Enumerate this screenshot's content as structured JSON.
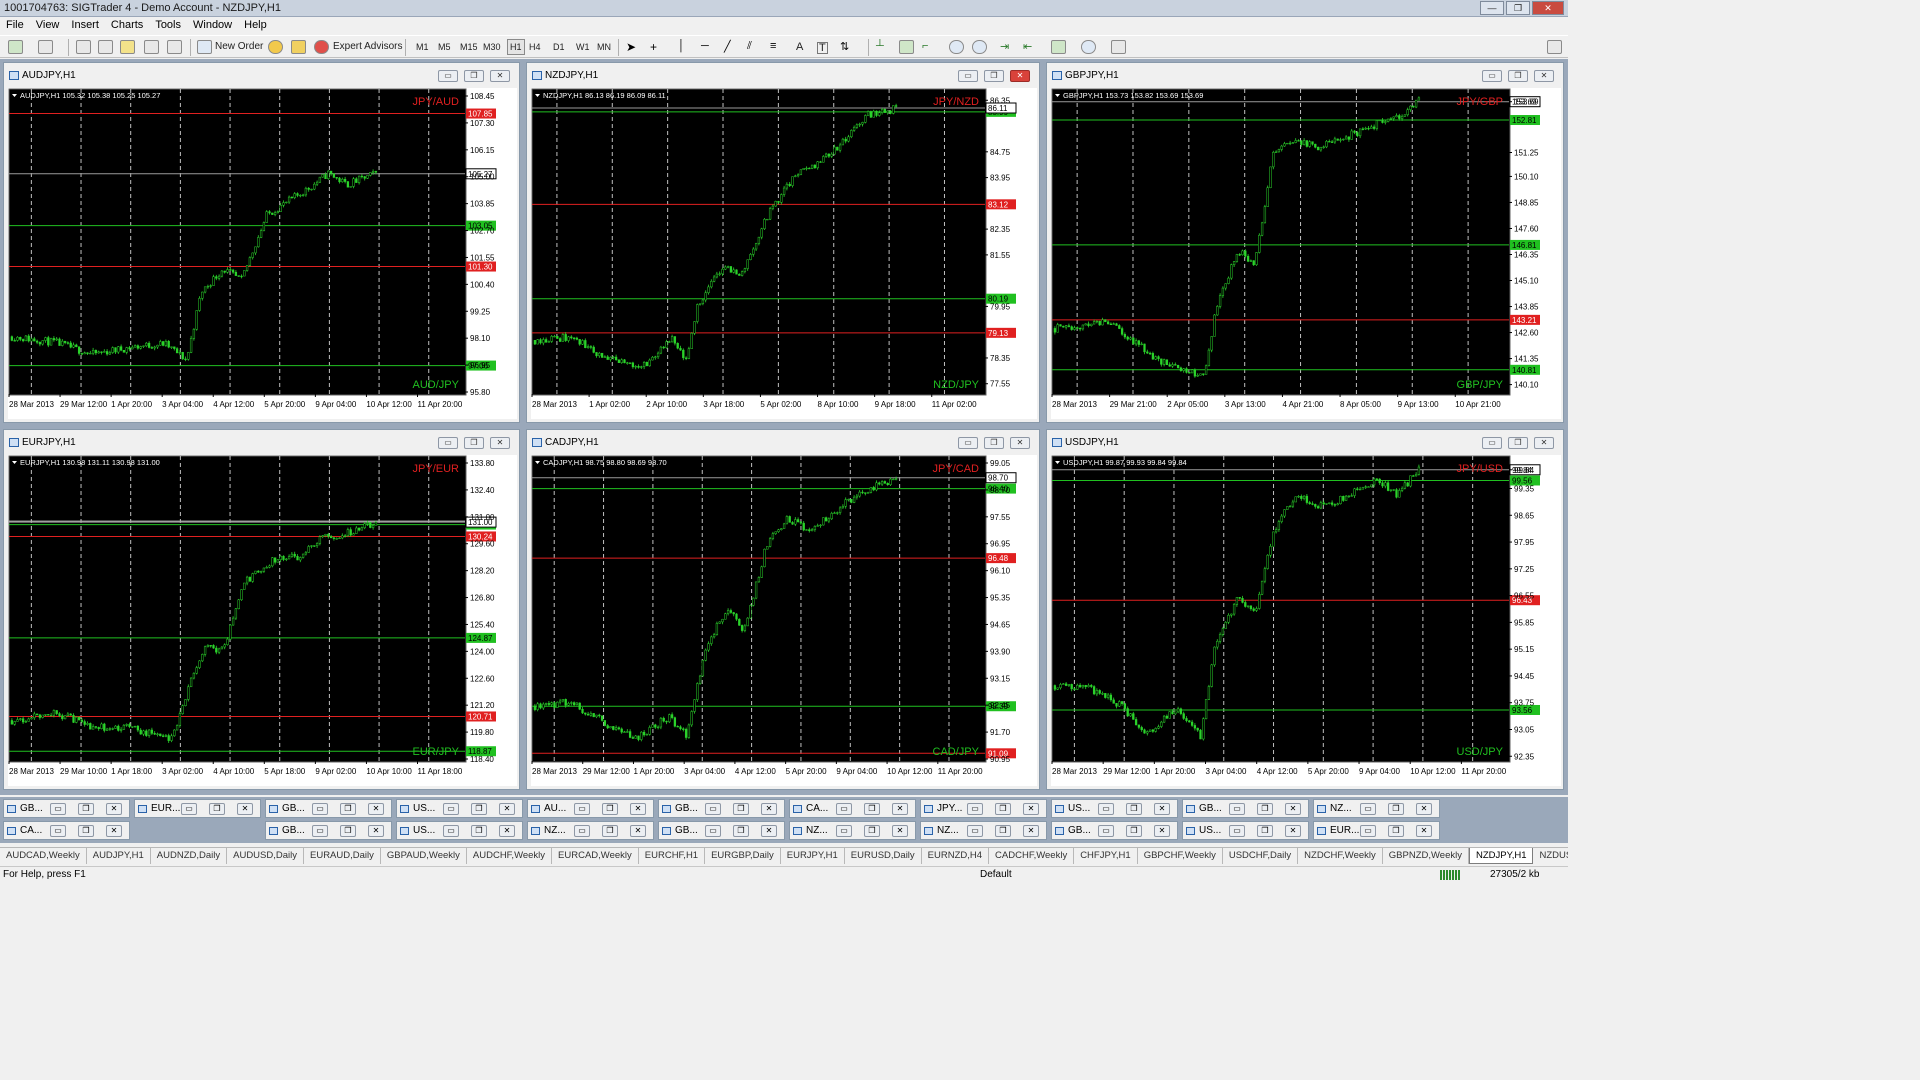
{
  "window": {
    "title": "1001704763: SIGTrader 4 - Demo Account - NZDJPY,H1"
  },
  "menu": [
    "File",
    "View",
    "Insert",
    "Charts",
    "Tools",
    "Window",
    "Help"
  ],
  "toolbar": {
    "new_order": "New Order",
    "expert_advisors": "Expert Advisors",
    "timeframes": [
      "M1",
      "M5",
      "M15",
      "M30",
      "H1",
      "H4",
      "D1",
      "W1",
      "MN"
    ],
    "text_tool": "A",
    "label_tool": "T"
  },
  "charts": [
    {
      "title": "AUDJPY,H1",
      "info": "AUDJPY,H1  105.32 105.38 105.25 105.27",
      "top_label": "JPY/AUD",
      "bottom_label": "AUD/JPY",
      "yticks": [
        "108.45",
        "107.30",
        "106.15",
        "105.00",
        "103.85",
        "102.70",
        "101.55",
        "100.40",
        "99.25",
        "98.10",
        "96.95",
        "95.80"
      ],
      "xticks": [
        "28 Mar 2013",
        "29 Mar 12:00",
        "1 Apr 20:00",
        "3 Apr 04:00",
        "4 Apr 12:00",
        "5 Apr 20:00",
        "9 Apr 04:00",
        "10 Apr 12:00",
        "11 Apr 20:00"
      ],
      "ymin": 95.8,
      "ymax": 108.9,
      "hlines": [
        {
          "v": 107.85,
          "c": "red",
          "label": "107.85"
        },
        {
          "v": 103.05,
          "c": "green",
          "label": "103.05"
        },
        {
          "v": 101.3,
          "c": "red",
          "label": "101.30"
        },
        {
          "v": 97.06,
          "c": "green",
          "label": "97.06"
        }
      ],
      "price": {
        "v": 105.27,
        "label": "105.27"
      },
      "anchors": [
        [
          0,
          98.3
        ],
        [
          0.12,
          98.05
        ],
        [
          0.22,
          97.55
        ],
        [
          0.33,
          97.85
        ],
        [
          0.42,
          98.0
        ],
        [
          0.48,
          97.3
        ],
        [
          0.52,
          100.2
        ],
        [
          0.58,
          101.2
        ],
        [
          0.63,
          100.7
        ],
        [
          0.7,
          103.5
        ],
        [
          0.76,
          104.1
        ],
        [
          0.82,
          104.7
        ],
        [
          0.87,
          105.3
        ],
        [
          0.92,
          104.8
        ],
        [
          1,
          105.3
        ]
      ],
      "seed": 11
    },
    {
      "title": "NZDJPY,H1",
      "info": "NZDJPY,H1  86.13 86.19 86.09 86.11",
      "top_label": "JPY/NZD",
      "bottom_label": "NZD/JPY",
      "yticks": [
        "86.35",
        "84.75",
        "83.95",
        "82.35",
        "81.55",
        "79.95",
        "78.35",
        "77.55"
      ],
      "yticks_v": [
        86.35,
        84.75,
        83.95,
        82.35,
        81.55,
        79.95,
        78.35,
        77.55
      ],
      "xticks": [
        "28 Mar 2013",
        "1 Apr 02:00",
        "2 Apr 10:00",
        "3 Apr 18:00",
        "5 Apr 02:00",
        "8 Apr 10:00",
        "9 Apr 18:00",
        "11 Apr 02:00"
      ],
      "ymin": 77.2,
      "ymax": 86.7,
      "hlines": [
        {
          "v": 85.99,
          "c": "green",
          "label": "85.99"
        },
        {
          "v": 83.12,
          "c": "red",
          "label": "83.12"
        },
        {
          "v": 80.19,
          "c": "green",
          "label": "80.19"
        },
        {
          "v": 79.13,
          "c": "red",
          "label": "79.13"
        }
      ],
      "price": {
        "v": 86.11,
        "label": "86.11"
      },
      "anchors": [
        [
          0,
          78.9
        ],
        [
          0.1,
          79.0
        ],
        [
          0.2,
          78.3
        ],
        [
          0.3,
          78.1
        ],
        [
          0.38,
          78.9
        ],
        [
          0.42,
          78.2
        ],
        [
          0.45,
          80.0
        ],
        [
          0.52,
          81.2
        ],
        [
          0.57,
          80.9
        ],
        [
          0.65,
          82.9
        ],
        [
          0.72,
          84.0
        ],
        [
          0.78,
          84.4
        ],
        [
          0.85,
          85.0
        ],
        [
          0.92,
          85.9
        ],
        [
          1,
          86.1
        ]
      ],
      "seed": 23
    },
    {
      "title": "GBPJPY,H1",
      "info": "GBPJPY,H1  153.73 153.82 153.69 153.69",
      "top_label": "JPY/GBP",
      "bottom_label": "GBP/JPY",
      "yticks": [
        "153.69",
        "151.25",
        "150.10",
        "148.85",
        "147.60",
        "146.35",
        "145.10",
        "143.85",
        "142.60",
        "141.35",
        "140.10"
      ],
      "yticks_v": [
        153.69,
        151.25,
        150.1,
        148.85,
        147.6,
        146.35,
        145.1,
        143.85,
        142.6,
        141.35,
        140.1
      ],
      "xticks": [
        "28 Mar 2013",
        "29 Mar 21:00",
        "2 Apr 05:00",
        "3 Apr 13:00",
        "4 Apr 21:00",
        "8 Apr 05:00",
        "9 Apr 13:00",
        "10 Apr 21:00"
      ],
      "ymin": 139.6,
      "ymax": 154.3,
      "hlines": [
        {
          "v": 152.81,
          "c": "green",
          "label": "152.81"
        },
        {
          "v": 146.81,
          "c": "green",
          "label": "146.81"
        },
        {
          "v": 143.21,
          "c": "red",
          "label": "143.21"
        },
        {
          "v": 140.81,
          "c": "green",
          "label": "140.81"
        }
      ],
      "price": {
        "v": 153.69,
        "label": "153.69"
      },
      "anchors": [
        [
          0,
          142.8
        ],
        [
          0.08,
          142.9
        ],
        [
          0.14,
          143.2
        ],
        [
          0.2,
          142.4
        ],
        [
          0.28,
          141.3
        ],
        [
          0.35,
          140.8
        ],
        [
          0.41,
          140.5
        ],
        [
          0.44,
          143.5
        ],
        [
          0.5,
          146.5
        ],
        [
          0.55,
          146.0
        ],
        [
          0.6,
          151.2
        ],
        [
          0.66,
          151.8
        ],
        [
          0.72,
          151.5
        ],
        [
          0.8,
          152.0
        ],
        [
          0.88,
          152.6
        ],
        [
          0.94,
          152.9
        ],
        [
          1,
          153.7
        ]
      ],
      "seed": 37
    },
    {
      "title": "EURJPY,H1",
      "info": "EURJPY,H1  130.98 131.11 130.98 131.00",
      "top_label": "JPY/EUR",
      "bottom_label": "EUR/JPY",
      "yticks": [
        "133.80",
        "132.40",
        "131.00",
        "129.60",
        "128.20",
        "126.80",
        "125.40",
        "124.00",
        "122.60",
        "121.20",
        "119.80",
        "118.40"
      ],
      "xticks": [
        "28 Mar 2013",
        "29 Mar 10:00",
        "1 Apr 18:00",
        "3 Apr 02:00",
        "4 Apr 10:00",
        "5 Apr 18:00",
        "9 Apr 02:00",
        "10 Apr 10:00",
        "11 Apr 18:00"
      ],
      "ymin": 118.3,
      "ymax": 134.5,
      "hlines": [
        {
          "v": 131.05,
          "c": "grey",
          "label": ""
        },
        {
          "v": 130.87,
          "c": "green",
          "label": "130.87"
        },
        {
          "v": 130.24,
          "c": "red",
          "label": "130.24"
        },
        {
          "v": 124.87,
          "c": "green",
          "label": "124.87"
        },
        {
          "v": 120.71,
          "c": "red",
          "label": "120.71"
        },
        {
          "v": 118.87,
          "c": "green",
          "label": "118.87"
        }
      ],
      "price": {
        "v": 131.0,
        "label": "131.00"
      },
      "anchors": [
        [
          0,
          120.5
        ],
        [
          0.12,
          120.9
        ],
        [
          0.22,
          120.2
        ],
        [
          0.32,
          120.1
        ],
        [
          0.44,
          119.5
        ],
        [
          0.48,
          122.0
        ],
        [
          0.53,
          124.5
        ],
        [
          0.58,
          124.2
        ],
        [
          0.64,
          127.8
        ],
        [
          0.72,
          129.0
        ],
        [
          0.79,
          129.2
        ],
        [
          0.85,
          130.2
        ],
        [
          0.92,
          130.4
        ],
        [
          1,
          131.0
        ]
      ],
      "seed": 53
    },
    {
      "title": "CADJPY,H1",
      "info": "CADJPY,H1  98.75 98.80 98.69 98.70",
      "top_label": "JPY/CAD",
      "bottom_label": "CAD/JPY",
      "yticks": [
        "99.05",
        "98.70",
        "97.55",
        "96.95",
        "96.10",
        "95.35",
        "94.65",
        "93.90",
        "93.15",
        "92.45",
        "91.70",
        "90.95"
      ],
      "xticks": [
        "28 Mar 2013",
        "29 Mar 12:00",
        "1 Apr 20:00",
        "3 Apr 04:00",
        "4 Apr 12:00",
        "5 Apr 20:00",
        "9 Apr 04:00",
        "10 Apr 12:00",
        "11 Apr 20:00"
      ],
      "ymin": 90.85,
      "ymax": 99.3,
      "hlines": [
        {
          "v": 98.4,
          "c": "green",
          "label": "98.40"
        },
        {
          "v": 96.48,
          "c": "red",
          "label": "96.48"
        },
        {
          "v": 92.39,
          "c": "green",
          "label": "92.39"
        },
        {
          "v": 91.09,
          "c": "red",
          "label": "91.09"
        }
      ],
      "price": {
        "v": 98.7,
        "label": "98.70"
      },
      "anchors": [
        [
          0,
          92.4
        ],
        [
          0.1,
          92.5
        ],
        [
          0.2,
          91.9
        ],
        [
          0.28,
          91.5
        ],
        [
          0.37,
          92.1
        ],
        [
          0.42,
          91.6
        ],
        [
          0.47,
          93.9
        ],
        [
          0.53,
          95.1
        ],
        [
          0.58,
          94.5
        ],
        [
          0.64,
          96.8
        ],
        [
          0.7,
          97.6
        ],
        [
          0.76,
          97.2
        ],
        [
          0.82,
          97.7
        ],
        [
          0.9,
          98.3
        ],
        [
          1,
          98.7
        ]
      ],
      "seed": 67
    },
    {
      "title": "USDJPY,H1",
      "info": "USDJPY,H1  99.87 99.93 99.84 99.84",
      "top_label": "JPY/USD",
      "bottom_label": "USD/JPY",
      "yticks": [
        "99.84",
        "99.35",
        "98.65",
        "97.95",
        "97.25",
        "96.55",
        "95.85",
        "95.15",
        "94.45",
        "93.75",
        "93.05",
        "92.35"
      ],
      "yticks_v": [
        99.84,
        99.35,
        98.65,
        97.95,
        97.25,
        96.55,
        95.85,
        95.15,
        94.45,
        93.75,
        93.05,
        92.35
      ],
      "xticks": [
        "28 Mar 2013",
        "29 Mar 12:00",
        "1 Apr 20:00",
        "3 Apr 04:00",
        "4 Apr 12:00",
        "5 Apr 20:00",
        "9 Apr 04:00",
        "10 Apr 12:00",
        "11 Apr 20:00"
      ],
      "ymin": 92.2,
      "ymax": 100.2,
      "hlines": [
        {
          "v": 99.56,
          "c": "green",
          "label": "99.56"
        },
        {
          "v": 96.43,
          "c": "red",
          "label": "96.43"
        },
        {
          "v": 93.56,
          "c": "green",
          "label": "93.56"
        }
      ],
      "price": {
        "v": 99.84,
        "label": "99.84"
      },
      "anchors": [
        [
          0,
          94.2
        ],
        [
          0.1,
          94.1
        ],
        [
          0.18,
          93.7
        ],
        [
          0.25,
          92.9
        ],
        [
          0.33,
          93.6
        ],
        [
          0.4,
          92.9
        ],
        [
          0.44,
          95.2
        ],
        [
          0.5,
          96.5
        ],
        [
          0.55,
          96.1
        ],
        [
          0.6,
          98.2
        ],
        [
          0.66,
          99.2
        ],
        [
          0.72,
          98.9
        ],
        [
          0.8,
          99.1
        ],
        [
          0.88,
          99.6
        ],
        [
          0.94,
          99.2
        ],
        [
          1,
          99.84
        ]
      ],
      "seed": 79
    }
  ],
  "minimized": [
    [
      "GB...",
      "EUR...",
      "GB...",
      "US...",
      "AU...",
      "GB...",
      "CA...",
      "JPY...",
      "US...",
      "GB...",
      "NZ...",
      "EUR..."
    ],
    [
      "CA...",
      "GB...",
      "US...",
      "NZ...",
      "GB...",
      "NZ...",
      "NZ...",
      "GB...",
      "US...",
      "EUR..."
    ]
  ],
  "tabs": [
    "AUDCAD,Weekly",
    "AUDJPY,H1",
    "AUDNZD,Daily",
    "AUDUSD,Daily",
    "EURAUD,Daily",
    "GBPAUD,Weekly",
    "AUDCHF,Weekly",
    "EURCAD,Weekly",
    "EURCHF,H1",
    "EURGBP,Daily",
    "EURJPY,H1",
    "EURUSD,Daily",
    "EURNZD,H4",
    "CADCHF,Weekly",
    "CHFJPY,H1",
    "GBPCHF,Weekly",
    "USDCHF,Daily",
    "NZDCHF,Weekly",
    "GBPNZD,Weekly",
    "NZDJPY,H1",
    "NZDUSD,D"
  ],
  "active_tab": "NZDJPY,H1",
  "status": {
    "help": "For Help, press F1",
    "profile": "Default",
    "traffic": "27305/2 kb"
  }
}
